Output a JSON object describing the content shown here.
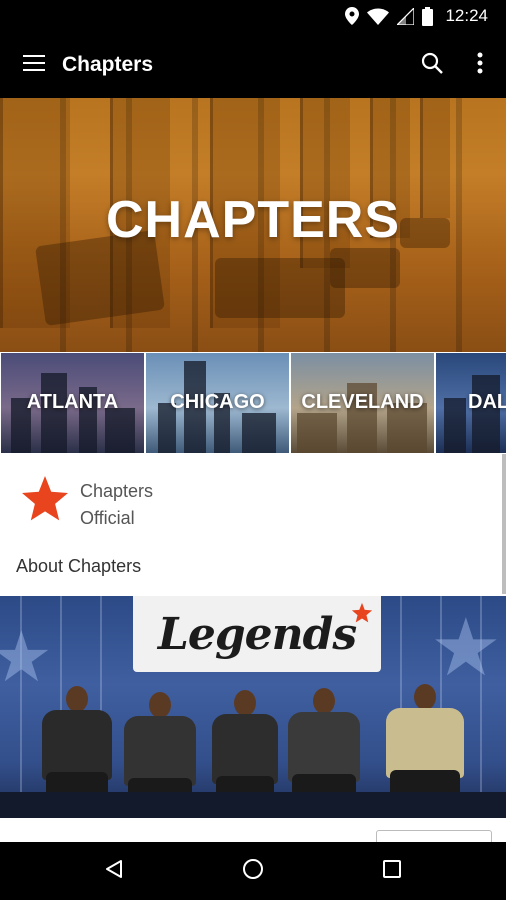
{
  "status_bar": {
    "time": "12:24",
    "icons": [
      "location-icon",
      "wifi-icon",
      "cell-signal-icon",
      "battery-icon"
    ]
  },
  "app_bar": {
    "title": "Chapters",
    "icons": [
      "hamburger-menu-icon",
      "search-icon",
      "more-vert-icon"
    ]
  },
  "hero": {
    "title": "CHAPTERS",
    "tint": "#b8741f"
  },
  "cities": [
    {
      "label": "ATLANTA"
    },
    {
      "label": "CHICAGO"
    },
    {
      "label": "CLEVELAND"
    },
    {
      "label": "DAL"
    }
  ],
  "org": {
    "name": "Chapters Official",
    "logo_icon": "star-icon",
    "accent": "#e8441e"
  },
  "about": {
    "heading": "About Chapters"
  },
  "legends_image": {
    "logo_text": "Legends",
    "accent": "#e8441e"
  },
  "nav": {
    "icons": [
      "back-icon",
      "home-icon",
      "recents-icon"
    ]
  }
}
